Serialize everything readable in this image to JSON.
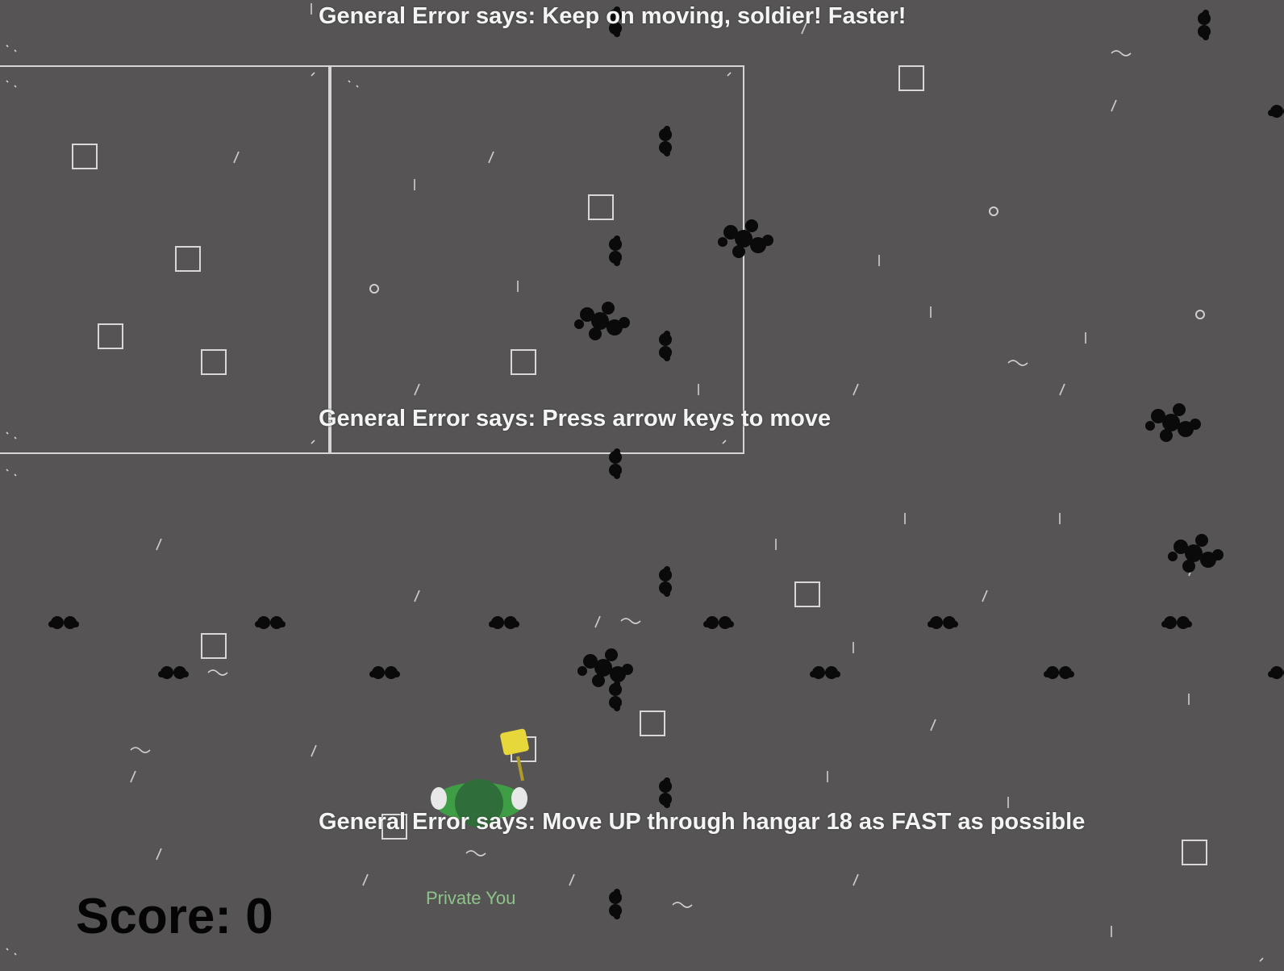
{
  "messages": {
    "top": "General Error says: Keep on moving, soldier! Faster!",
    "middle": "General Error says: Press arrow keys to move",
    "bottom": "General Error says: Move UP through hangar 18 as FAST as possible"
  },
  "hud": {
    "score_label": "Score: 0",
    "score_value": 0
  },
  "player": {
    "name": "Private You",
    "body_color": "#3f9e45",
    "helmet_color": "#2f6e3a",
    "flag_color": "#e8d73a"
  },
  "colors": {
    "ground": "#565454",
    "outline": "#d6d6d6",
    "blot": "#0a0a0a",
    "message_text": "#f4f4f4",
    "score_text": "#050505",
    "name_text": "#8ec48a"
  },
  "icons": {
    "crate": "crate-icon",
    "blot": "oil-blot-icon",
    "bolt": "bolt-icon",
    "player": "soldier-icon",
    "flag": "flag-icon"
  }
}
